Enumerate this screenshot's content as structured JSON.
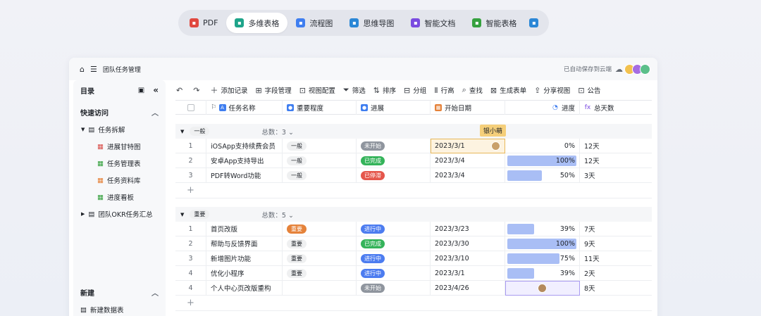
{
  "top_tabs": [
    {
      "label": "PDF",
      "icon": "pdf-icon",
      "color": "#e0483f"
    },
    {
      "label": "多维表格",
      "icon": "multi-table-icon",
      "color": "#1ea48a",
      "active": true
    },
    {
      "label": "流程图",
      "icon": "flowchart-icon",
      "color": "#3f7ef0"
    },
    {
      "label": "思维导图",
      "icon": "mindmap-icon",
      "color": "#2b87d6"
    },
    {
      "label": "智能文档",
      "icon": "smart-doc-icon",
      "color": "#7a4be0"
    },
    {
      "label": "智能表格",
      "icon": "smart-table-icon",
      "color": "#36a13f"
    }
  ],
  "window": {
    "title": "团队任务管理",
    "autosave": "已自动保存到云端"
  },
  "sidebar": {
    "title": "目录",
    "quick": "快速访问",
    "group1": "任务拆解",
    "items": [
      {
        "label": "进展甘特图",
        "icon": "gantt-icon",
        "color": "#d9534f"
      },
      {
        "label": "任务管理表",
        "icon": "table-icon",
        "color": "#36a13f"
      },
      {
        "label": "任务资料库",
        "icon": "gallery-icon",
        "color": "#e5823a"
      },
      {
        "label": "进度看板",
        "icon": "kanban-icon",
        "color": "#36a13f"
      }
    ],
    "group2": "团队OKR任务汇总",
    "new": "新建",
    "new_table": "新建数据表"
  },
  "toolbar": [
    "添加记录",
    "字段管理",
    "视图配置",
    "筛选",
    "排序",
    "分组",
    "行高",
    "查找",
    "生成表单",
    "分享视图",
    "公告"
  ],
  "columns": [
    "任务名称",
    "重要程度",
    "进展",
    "开始日期",
    "进度",
    "总天数"
  ],
  "collaborator": "银小萌",
  "groups": [
    {
      "tag": "一般",
      "tag_style": "gray",
      "count_label": "总数：3 ⌄",
      "rows": [
        {
          "n": "1",
          "name": "iOSApp支持续费会员",
          "level": "一般",
          "level_style": "gray",
          "status": "未开始",
          "status_color": "#8f959e",
          "date": "2023/3/1",
          "pct": "0%",
          "fill": 0,
          "days": "12天"
        },
        {
          "n": "2",
          "name": "安卓App支持导出",
          "level": "一般",
          "level_style": "gray",
          "status": "已完成",
          "status_color": "#34b35a",
          "date": "2023/3/4",
          "pct": "100%",
          "fill": 1,
          "days": "12天"
        },
        {
          "n": "3",
          "name": "PDF转Word功能",
          "level": "一般",
          "level_style": "gray",
          "status": "已停滞",
          "status_color": "#e5564b",
          "date": "2023/3/4",
          "pct": "50%",
          "fill": 0.5,
          "days": "3天"
        }
      ]
    },
    {
      "tag": "重要",
      "tag_style": "gray",
      "count_label": "总数：5 ⌄",
      "rows": [
        {
          "n": "1",
          "name": "首页改版",
          "level": "重要",
          "level_style": "orange",
          "status": "进行中",
          "status_color": "#4c7cf0",
          "date": "2023/3/23",
          "pct": "39%",
          "fill": 0.39,
          "days": "7天"
        },
        {
          "n": "2",
          "name": "帮助与反馈界面",
          "level": "重要",
          "level_style": "gray",
          "status": "已完成",
          "status_color": "#34b35a",
          "date": "2023/3/30",
          "pct": "100%",
          "fill": 1,
          "days": "9天"
        },
        {
          "n": "3",
          "name": "新增图片功能",
          "level": "重要",
          "level_style": "gray",
          "status": "进行中",
          "status_color": "#4c7cf0",
          "date": "2023/3/10",
          "pct": "75%",
          "fill": 0.75,
          "days": "11天"
        },
        {
          "n": "4",
          "name": "优化小程序",
          "level": "重要",
          "level_style": "gray",
          "status": "进行中",
          "status_color": "#4c7cf0",
          "date": "2023/3/1",
          "pct": "39%",
          "fill": 0.39,
          "days": "2天"
        },
        {
          "n": "4",
          "name": "个人中心页改版重构",
          "level": "",
          "level_style": "gray",
          "status": "未开始",
          "status_color": "#8f959e",
          "date": "2023/4/26",
          "pct": "",
          "fill": 0,
          "days": "8天"
        }
      ]
    }
  ]
}
